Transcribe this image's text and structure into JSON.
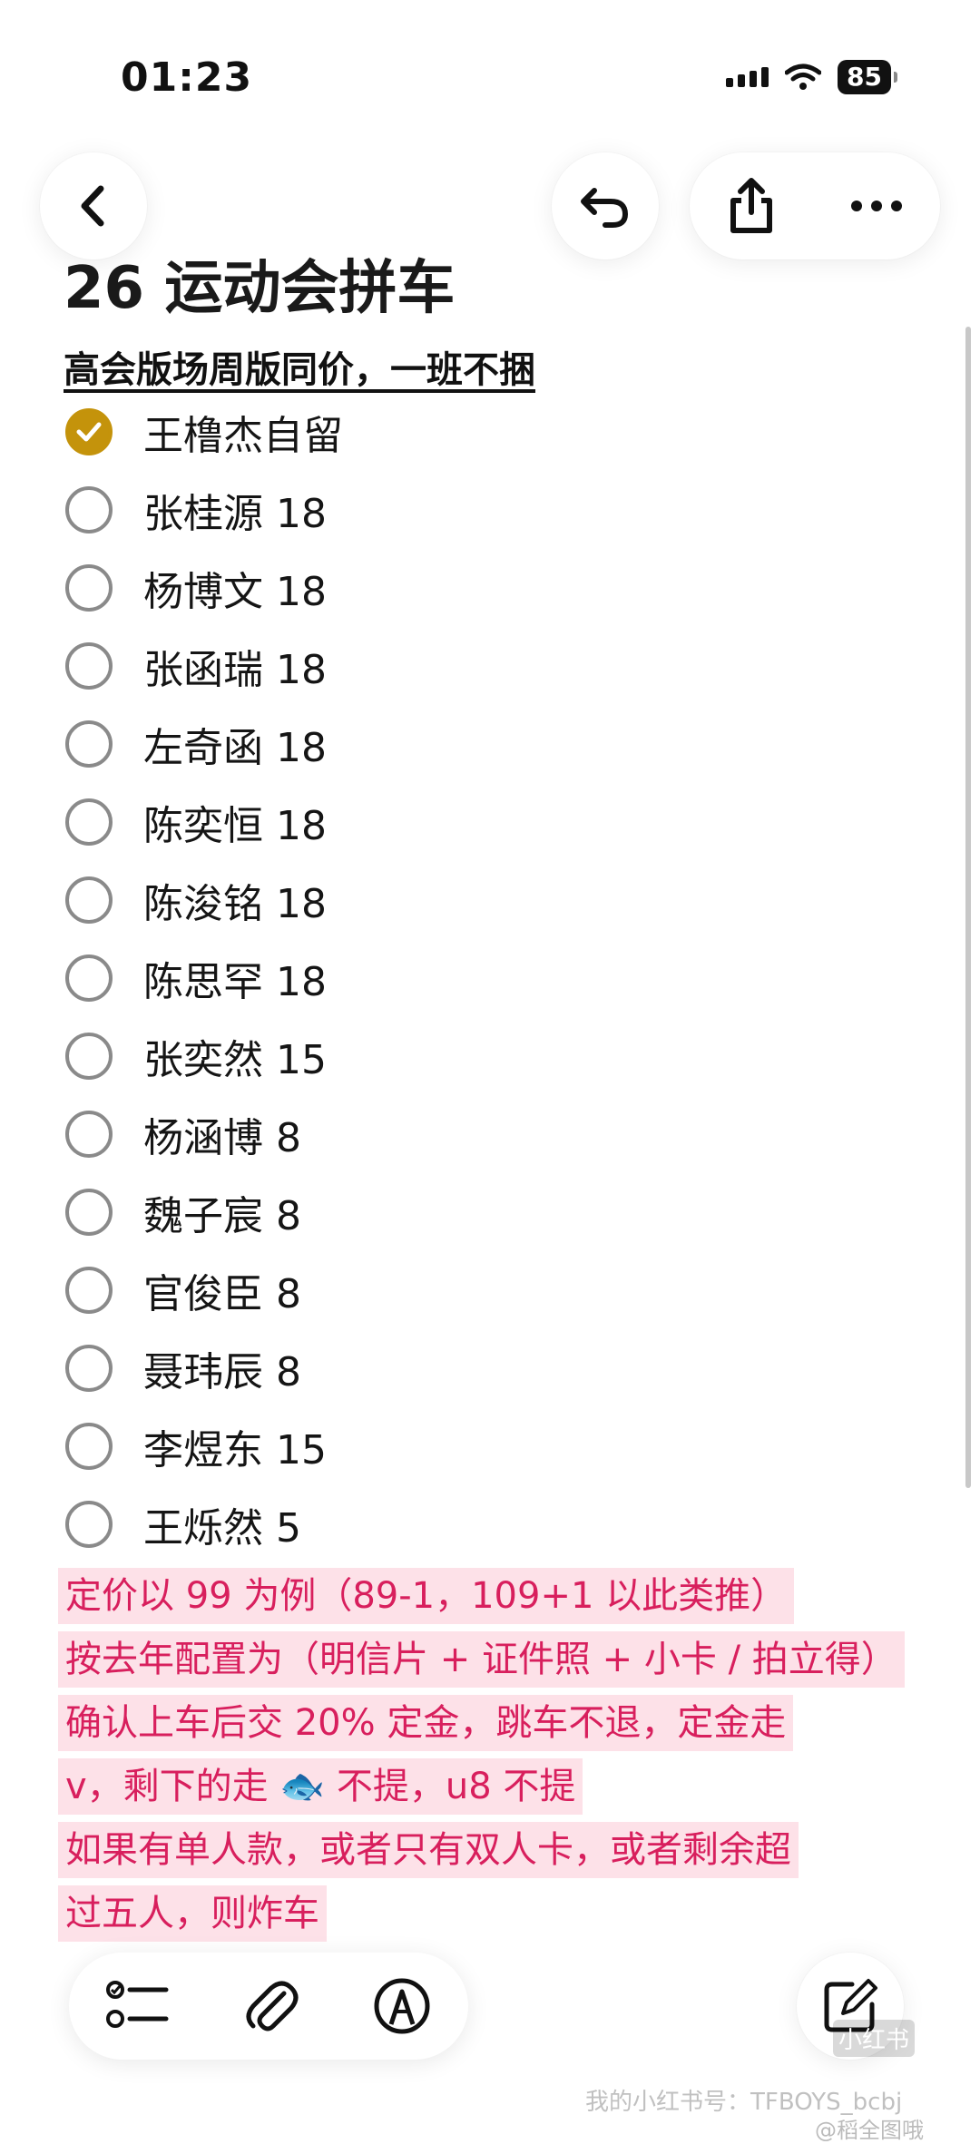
{
  "status_bar": {
    "time": "01:23",
    "battery": "85"
  },
  "note": {
    "title": "26 运动会拼车",
    "subtitle": "高会版场周版同价，一班不捆",
    "checklist": [
      {
        "label": "王橹杰自留",
        "checked": true
      },
      {
        "label": "张桂源 18",
        "checked": false
      },
      {
        "label": "杨博文 18",
        "checked": false
      },
      {
        "label": "张函瑞 18",
        "checked": false
      },
      {
        "label": "左奇函 18",
        "checked": false
      },
      {
        "label": "陈奕恒 18",
        "checked": false
      },
      {
        "label": "陈浚铭 18",
        "checked": false
      },
      {
        "label": "陈思罕 18",
        "checked": false
      },
      {
        "label": "张奕然 15",
        "checked": false
      },
      {
        "label": "杨涵博 8",
        "checked": false
      },
      {
        "label": "魏子宸 8",
        "checked": false
      },
      {
        "label": "官俊臣 8",
        "checked": false
      },
      {
        "label": "聂玮辰 8",
        "checked": false
      },
      {
        "label": "李煜东 15",
        "checked": false
      },
      {
        "label": "王烁然 5",
        "checked": false
      }
    ],
    "highlight_lines": [
      "定价以 99 为例（89-1，109+1 以此类推）",
      "按去年配置为（明信片 + 证件照 + 小卡 / 拍立得）",
      "确认上车后交 20% 定金，跳车不退，定金走",
      "v，剩下的走 🐟 不提，u8 不提",
      "如果有单人款，或者只有双人卡，或者剩余超",
      "过五人，则炸车"
    ]
  },
  "icons": {
    "back": "chevron-left-icon",
    "undo": "undo-icon",
    "share": "share-icon",
    "more": "more-icon",
    "checklist": "checklist-icon",
    "attach": "paperclip-icon",
    "markup": "markup-pen-icon",
    "compose": "compose-icon"
  },
  "watermarks": {
    "badge": "小红书",
    "xhs_id": "我的小红书号：TFBOYS_bcbj",
    "weibo": "@稻全图哦"
  },
  "colors": {
    "check_accent": "#c4930b",
    "highlight_text": "#d81f5d",
    "highlight_bg": "#fde1e8"
  }
}
